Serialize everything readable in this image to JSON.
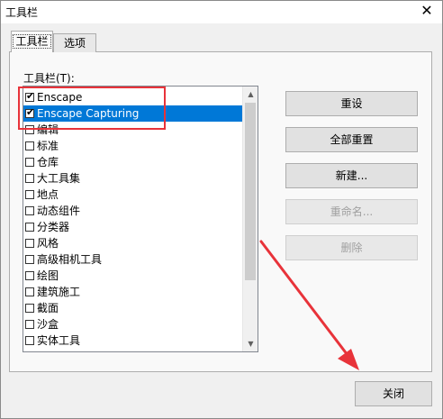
{
  "window": {
    "title": "工具栏",
    "close_glyph": "✕"
  },
  "tabs": [
    {
      "label": "工具栏",
      "active": true
    },
    {
      "label": "选项",
      "active": false
    }
  ],
  "toolbars_label": "工具栏(T):",
  "toolbars": [
    {
      "label": "Enscape",
      "checked": true,
      "selected": false
    },
    {
      "label": "Enscape Capturing",
      "checked": true,
      "selected": true
    },
    {
      "label": "编辑",
      "checked": false,
      "selected": false
    },
    {
      "label": "标准",
      "checked": false,
      "selected": false
    },
    {
      "label": "仓库",
      "checked": false,
      "selected": false
    },
    {
      "label": "大工具集",
      "checked": false,
      "selected": false
    },
    {
      "label": "地点",
      "checked": false,
      "selected": false
    },
    {
      "label": "动态组件",
      "checked": false,
      "selected": false
    },
    {
      "label": "分类器",
      "checked": false,
      "selected": false
    },
    {
      "label": "风格",
      "checked": false,
      "selected": false
    },
    {
      "label": "高级相机工具",
      "checked": false,
      "selected": false
    },
    {
      "label": "绘图",
      "checked": false,
      "selected": false
    },
    {
      "label": "建筑施工",
      "checked": false,
      "selected": false
    },
    {
      "label": "截面",
      "checked": false,
      "selected": false
    },
    {
      "label": "沙盒",
      "checked": false,
      "selected": false
    },
    {
      "label": "实体工具",
      "checked": false,
      "selected": false
    }
  ],
  "buttons": {
    "reset": "重设",
    "reset_all": "全部重置",
    "new": "新建...",
    "rename": "重命名...",
    "delete": "删除",
    "close": "关闭"
  },
  "colors": {
    "annotation": "#e8333a",
    "selection": "#0078d7"
  }
}
